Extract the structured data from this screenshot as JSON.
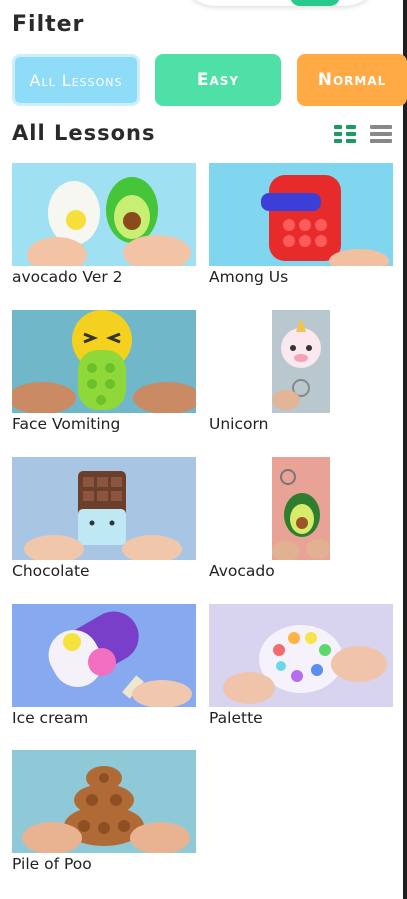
{
  "filter": {
    "title": "Filter"
  },
  "chips": [
    {
      "label": "All Lessons"
    },
    {
      "label": "Easy"
    },
    {
      "label": "Normal"
    }
  ],
  "section": {
    "title": "All Lessons"
  },
  "colors": {
    "all": "#8fdcf9",
    "easy": "#4fe0a8",
    "normal": "#ffaa45",
    "active_view": "#1a9b62",
    "inactive_view": "#888888"
  },
  "lessons": [
    {
      "title": "avocado Ver 2"
    },
    {
      "title": "Among Us"
    },
    {
      "title": "Face Vomiting"
    },
    {
      "title": "Unicorn"
    },
    {
      "title": "Chocolate"
    },
    {
      "title": "Avocado"
    },
    {
      "title": "Ice cream"
    },
    {
      "title": "Palette"
    },
    {
      "title": "Pile of Poo"
    }
  ]
}
